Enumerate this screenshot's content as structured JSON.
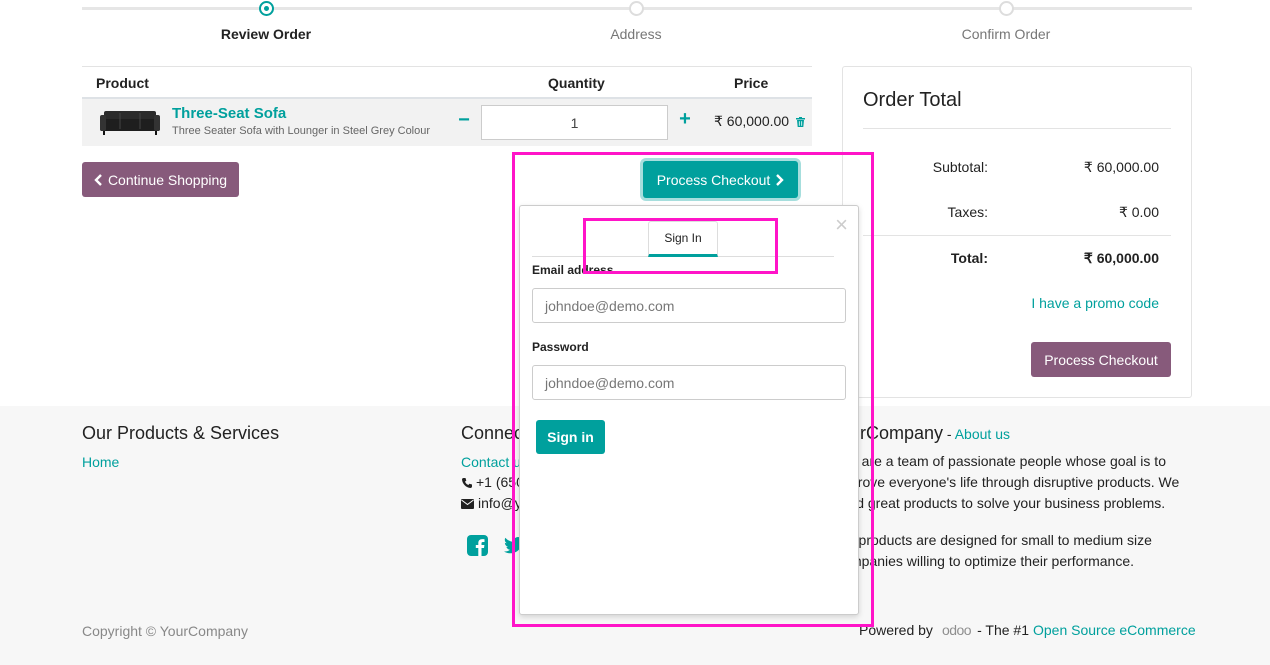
{
  "steps": [
    {
      "label": "Review Order"
    },
    {
      "label": "Address"
    },
    {
      "label": "Confirm Order"
    }
  ],
  "cart": {
    "headers": {
      "product": "Product",
      "quantity": "Quantity",
      "price": "Price"
    },
    "rows": [
      {
        "name": "Three-Seat Sofa",
        "description": "Three Seater Sofa with Lounger in Steel Grey Colour",
        "quantity": "1",
        "price": "₹ 60,000.00"
      }
    ],
    "minus": "−",
    "plus": "+"
  },
  "actions": {
    "continue_shopping": "Continue Shopping",
    "process_checkout": "Process Checkout"
  },
  "order_total": {
    "title": "Order Total",
    "subtotal_label": "Subtotal:",
    "subtotal_value": "₹ 60,000.00",
    "taxes_label": "Taxes:",
    "taxes_value": "₹ 0.00",
    "total_label": "Total:",
    "total_value": "₹ 60,000.00",
    "promo": "I have a promo code",
    "checkout": "Process Checkout"
  },
  "popover": {
    "close": "×",
    "tab": "Sign In",
    "email_label": "Email address",
    "email_placeholder": "johndoe@demo.com",
    "password_label": "Password",
    "password_placeholder": "johndoe@demo.com",
    "submit": "Sign in"
  },
  "footer": {
    "products_title": "Our Products & Services",
    "home_link": "Home",
    "connect_title_partial": "Connec",
    "contact_partial": "Contact u",
    "phone_partial": "+1 (650",
    "email_partial": "info@y",
    "about_title_partial": "urCompany",
    "about_sep": " - ",
    "about_link": "About us",
    "about_p1_lines": [
      "e are a team of passionate people whose goal is to",
      "prove everyone's life through disruptive products. We",
      "ild great products to solve your business problems."
    ],
    "about_p2_lines": [
      "r products are designed for small to medium size",
      "mpanies willing to optimize their performance."
    ],
    "copyright": "Copyright © YourCompany",
    "powered_by": "Powered by",
    "odoo_logo": "odoo",
    "the_number_one": "- The #1",
    "open_source": "Open Source eCommerce"
  },
  "colors": {
    "teal": "#00a09d",
    "purple": "#875a7b",
    "annotation": "#ff14c8"
  }
}
